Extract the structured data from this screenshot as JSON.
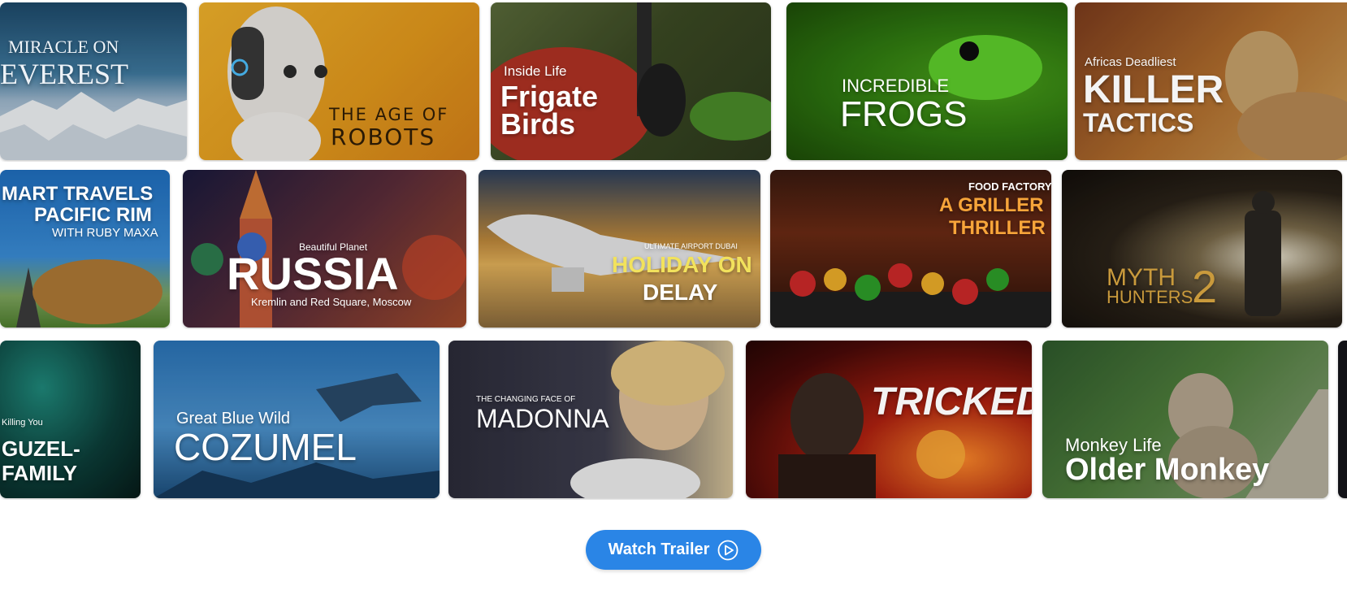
{
  "rows": [
    {
      "cards": [
        {
          "kicker": "",
          "title": "MIRACLE ON",
          "title2": "EVEREST",
          "extra": ""
        },
        {
          "kicker": "",
          "title": "THE AGE OF",
          "title2": "ROBOTS",
          "extra": ""
        },
        {
          "kicker": "Inside Life",
          "title": "Frigate",
          "title2": "Birds",
          "extra": ""
        },
        {
          "kicker": "",
          "title": "INCREDIBLE",
          "title2": "FROGS",
          "extra": ""
        },
        {
          "kicker": "Africas Deadliest",
          "title": "KILLER",
          "title2": "TACTICS",
          "extra": ""
        }
      ]
    },
    {
      "cards": [
        {
          "kicker": "",
          "title": "MART TRAVELS",
          "title2": "PACIFIC RIM",
          "extra": "WITH RUBY MAXA"
        },
        {
          "kicker": "Beautiful Planet",
          "title": "RUSSIA",
          "title2": "",
          "extra": "Kremlin and Red Square, Moscow"
        },
        {
          "kicker": "ULTIMATE AIRPORT DUBAI",
          "title": "HOLIDAY ON",
          "title2": "DELAY",
          "extra": ""
        },
        {
          "kicker": "FOOD FACTORY",
          "title": "A GRILLER",
          "title2": "THRILLER",
          "extra": ""
        },
        {
          "kicker": "",
          "title": "MYTH",
          "title2": "HUNTERS",
          "extra": "2"
        }
      ]
    },
    {
      "cards": [
        {
          "kicker": "Killing You",
          "title": "GUZEL-",
          "title2": "FAMILY",
          "extra": ""
        },
        {
          "kicker": "Great Blue Wild",
          "title": "COZUMEL",
          "title2": "",
          "extra": ""
        },
        {
          "kicker": "THE CHANGING FACE OF",
          "title": "MADONNA",
          "title2": "",
          "extra": ""
        },
        {
          "kicker": "",
          "title": "TRICKED",
          "title2": "",
          "extra": ""
        },
        {
          "kicker": "Monkey Life",
          "title": "Older Monkey",
          "title2": "",
          "extra": ""
        }
      ]
    }
  ],
  "cta": {
    "label": "Watch Trailer",
    "icon": "play-circle-icon"
  },
  "colors": {
    "cta_bg": "#2a85e6"
  }
}
